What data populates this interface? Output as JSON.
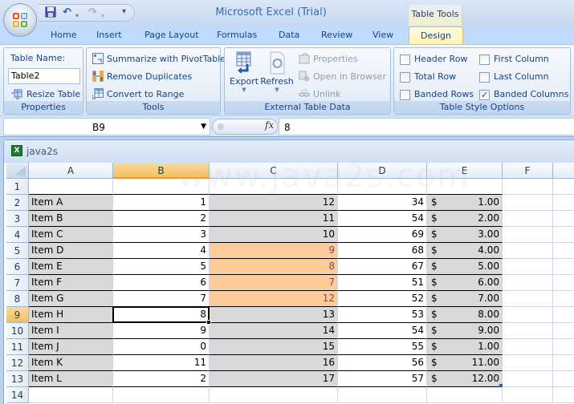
{
  "app": {
    "title": "Microsoft Excel (Trial)",
    "context_tab_group": "Table Tools"
  },
  "quick_access": {
    "items": [
      {
        "name": "save-icon",
        "glyph": "💾"
      },
      {
        "name": "undo-icon",
        "glyph": "↶"
      },
      {
        "name": "redo-icon",
        "glyph": "↷"
      }
    ],
    "customize_glyph": "▾"
  },
  "tabs": [
    {
      "label": "Home",
      "active": false
    },
    {
      "label": "Insert",
      "active": false
    },
    {
      "label": "Page Layout",
      "active": false
    },
    {
      "label": "Formulas",
      "active": false
    },
    {
      "label": "Data",
      "active": false
    },
    {
      "label": "Review",
      "active": false
    },
    {
      "label": "View",
      "active": false
    },
    {
      "label": "Design",
      "active": true
    }
  ],
  "ribbon": {
    "properties": {
      "label": "Properties",
      "table_name_label": "Table Name:",
      "table_name_value": "Table2",
      "resize_table": "Resize Table"
    },
    "tools": {
      "label": "Tools",
      "summarize": "Summarize with PivotTable",
      "remove_duplicates": "Remove Duplicates",
      "convert_to_range": "Convert to Range"
    },
    "external": {
      "label": "External Table Data",
      "export": "Export",
      "refresh": "Refresh",
      "properties": "Properties",
      "open_in_browser": "Open in Browser",
      "unlink": "Unlink"
    },
    "style_options": {
      "label": "Table Style Options",
      "header_row": {
        "label": "Header Row",
        "checked": false
      },
      "total_row": {
        "label": "Total Row",
        "checked": false
      },
      "banded_rows": {
        "label": "Banded Rows",
        "checked": false
      },
      "first_column": {
        "label": "First Column",
        "checked": false
      },
      "last_column": {
        "label": "Last Column",
        "checked": false
      },
      "banded_columns": {
        "label": "Banded Columns",
        "checked": true
      }
    }
  },
  "formula_bar": {
    "name_box": "B9",
    "fx_label": "fx",
    "formula": "8"
  },
  "workbook": {
    "title": "java2s",
    "watermark": "www.java2s.com"
  },
  "grid": {
    "columns": [
      "A",
      "B",
      "C",
      "D",
      "E",
      "F"
    ],
    "selected_column": "B",
    "selected_row": 9,
    "active_cell": "B9",
    "rows": [
      {
        "row": 1,
        "A": "",
        "B": "",
        "C": "",
        "D": "",
        "E_sym": "",
        "E": ""
      },
      {
        "row": 2,
        "A": "Item A",
        "B": "1",
        "C": "12",
        "D": "34",
        "E_sym": "$",
        "E": "1.00"
      },
      {
        "row": 3,
        "A": "Item B",
        "B": "2",
        "C": "11",
        "D": "54",
        "E_sym": "$",
        "E": "2.00"
      },
      {
        "row": 4,
        "A": "Item C",
        "B": "3",
        "C": "10",
        "D": "69",
        "E_sym": "$",
        "E": "3.00"
      },
      {
        "row": 5,
        "A": "Item D",
        "B": "4",
        "C": "9",
        "D": "68",
        "E_sym": "$",
        "E": "4.00",
        "C_highlight": true
      },
      {
        "row": 6,
        "A": "Item E",
        "B": "5",
        "C": "8",
        "D": "67",
        "E_sym": "$",
        "E": "5.00",
        "C_highlight": true
      },
      {
        "row": 7,
        "A": "Item F",
        "B": "6",
        "C": "7",
        "D": "51",
        "E_sym": "$",
        "E": "6.00",
        "C_highlight": true
      },
      {
        "row": 8,
        "A": "Item G",
        "B": "7",
        "C": "12",
        "D": "52",
        "E_sym": "$",
        "E": "7.00",
        "C_highlight": true
      },
      {
        "row": 9,
        "A": "Item H",
        "B": "8",
        "C": "13",
        "D": "53",
        "E_sym": "$",
        "E": "8.00"
      },
      {
        "row": 10,
        "A": "Item I",
        "B": "9",
        "C": "14",
        "D": "54",
        "E_sym": "$",
        "E": "9.00"
      },
      {
        "row": 11,
        "A": "Item J",
        "B": "0",
        "C": "15",
        "D": "55",
        "E_sym": "$",
        "E": "1.00"
      },
      {
        "row": 12,
        "A": "Item K",
        "B": "11",
        "C": "16",
        "D": "56",
        "E_sym": "$",
        "E": "11.00"
      },
      {
        "row": 13,
        "A": "Item L",
        "B": "2",
        "C": "17",
        "D": "57",
        "E_sym": "$",
        "E": "12.00"
      },
      {
        "row": 14,
        "A": "",
        "B": "",
        "C": "",
        "D": "",
        "E_sym": "",
        "E": ""
      }
    ]
  },
  "colors": {
    "band_gray": "#d9d9d9",
    "highlight_orange": "#ffcc99",
    "selected_header": "#f1c15f",
    "ribbon_text": "#15428b"
  }
}
